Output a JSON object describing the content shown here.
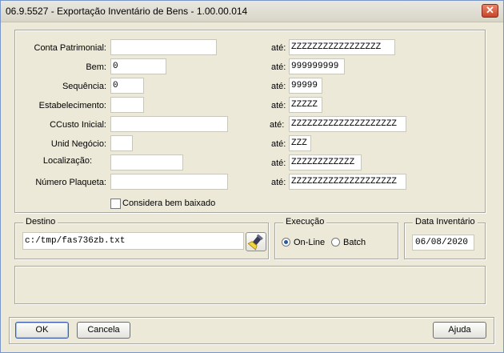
{
  "window": {
    "title": "06.9.5527 - Exportação Inventário de Bens - 1.00.00.014",
    "close_glyph": "✕"
  },
  "filters": {
    "ate_label": "até:",
    "rows": [
      {
        "label": "Conta Patrimonial:",
        "from": "",
        "to": "ZZZZZZZZZZZZZZZZZ"
      },
      {
        "label": "Bem:",
        "from": "0",
        "to": "999999999"
      },
      {
        "label": "Sequência:",
        "from": "0",
        "to": "99999"
      },
      {
        "label": "Estabelecimento:",
        "from": "",
        "to": "ZZZZZ"
      },
      {
        "label": "CCusto Inicial:",
        "from": "",
        "to": "ZZZZZZZZZZZZZZZZZZZZ"
      },
      {
        "label": "Unid Negócio:",
        "from": "",
        "to": "ZZZ"
      },
      {
        "label": "Localização:",
        "from": "",
        "to": "ZZZZZZZZZZZZ"
      },
      {
        "label": "Número Plaqueta:",
        "from": "",
        "to": "ZZZZZZZZZZZZZZZZZZZZ"
      }
    ],
    "considera_label": "Considera bem baixado",
    "considera_checked": false
  },
  "destino": {
    "legend": "Destino",
    "path": "c:/tmp/fas736zb.txt",
    "browse_icon": "flashlight-search-icon"
  },
  "execucao": {
    "legend": "Execução",
    "options": [
      {
        "label": "On-Line",
        "selected": true
      },
      {
        "label": "Batch",
        "selected": false
      }
    ]
  },
  "data_inventario": {
    "legend": "Data Inventário",
    "value": "06/08/2020"
  },
  "buttons": {
    "ok": "OK",
    "cancel": "Cancela",
    "help": "Ajuda"
  }
}
